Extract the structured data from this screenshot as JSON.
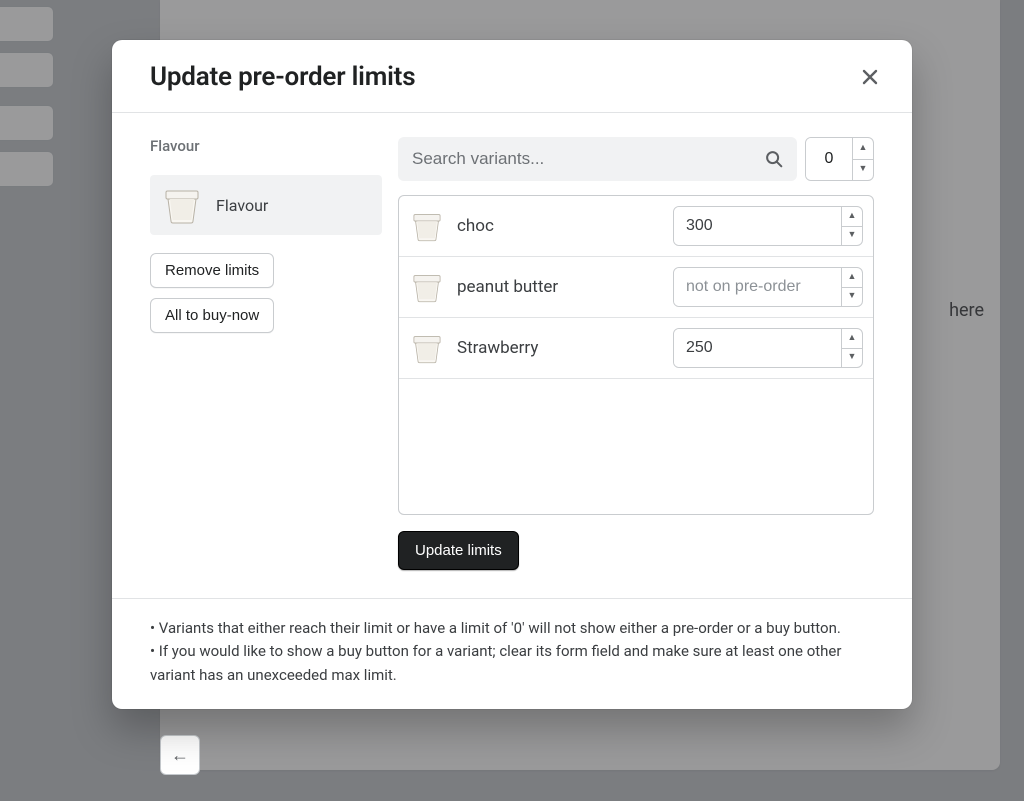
{
  "bg": {
    "here_text": "here",
    "back_glyph": "←"
  },
  "modal": {
    "title": "Update pre-order limits",
    "heading": "Flavour",
    "option_label": "Flavour",
    "remove_limits_label": "Remove limits",
    "all_to_buy_now_label": "All to buy-now",
    "search_placeholder": "Search variants...",
    "bulk_value": "0",
    "primary_label": "Update limits",
    "variants": [
      {
        "name": "choc",
        "value": "300",
        "placeholder": ""
      },
      {
        "name": "peanut butter",
        "value": "",
        "placeholder": "not on pre-order"
      },
      {
        "name": "Strawberry",
        "value": "250",
        "placeholder": ""
      }
    ],
    "footer_line1": "• Variants that either reach their limit or have a limit of '0' will not show either a pre-order or a buy button.",
    "footer_line2": "• If you would like to show a buy button for a variant; clear its form field and make sure at least one other variant has an unexceeded max limit."
  }
}
